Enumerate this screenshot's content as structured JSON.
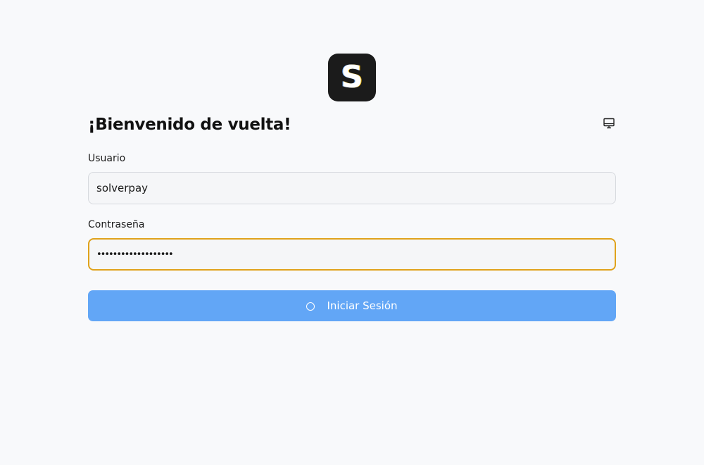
{
  "logo": {
    "letter": "S"
  },
  "heading": "¡Bienvenido de vuelta!",
  "theme_toggle": {
    "icon": "monitor-icon"
  },
  "form": {
    "username_label": "Usuario",
    "username_value": "solverpay",
    "password_label": "Contraseña",
    "password_value": "•••••••••••••••••••",
    "submit_label": "Iniciar Sesión"
  },
  "colors": {
    "background": "#f8f9fb",
    "logo_bg": "#1b1b1b",
    "focus_border": "#e0a21c",
    "button_bg": "#62a6f6"
  }
}
